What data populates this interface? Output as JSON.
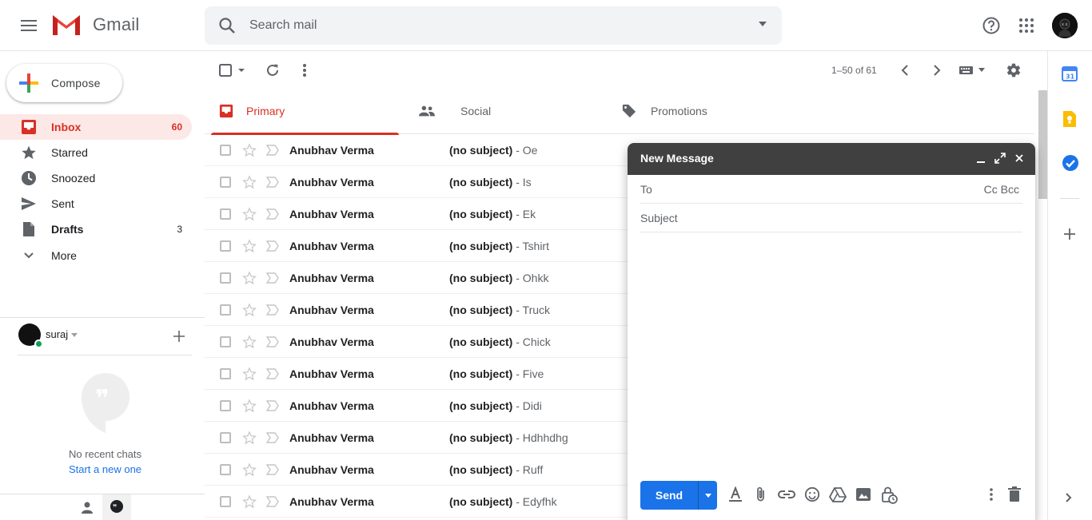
{
  "header": {
    "app_name": "Gmail",
    "search_placeholder": "Search mail"
  },
  "nav": {
    "compose_label": "Compose",
    "items": [
      {
        "label": "Inbox",
        "count": "60",
        "icon": "inbox-icon"
      },
      {
        "label": "Starred",
        "count": "",
        "icon": "star-icon"
      },
      {
        "label": "Snoozed",
        "count": "",
        "icon": "clock-icon"
      },
      {
        "label": "Sent",
        "count": "",
        "icon": "send-icon"
      },
      {
        "label": "Drafts",
        "count": "3",
        "icon": "draft-icon"
      },
      {
        "label": "More",
        "count": "",
        "icon": "chevron-down-icon"
      }
    ]
  },
  "hangouts": {
    "user_name": "suraj",
    "empty_text": "No recent chats",
    "start_link": "Start a new one"
  },
  "toolbar": {
    "pagination": "1–50 of 61"
  },
  "tabs": [
    {
      "label": "Primary",
      "icon": "inbox-icon",
      "active": true
    },
    {
      "label": "Social",
      "icon": "people-icon",
      "active": false
    },
    {
      "label": "Promotions",
      "icon": "tag-icon",
      "active": false
    }
  ],
  "emails": [
    {
      "sender": "Anubhav Verma",
      "subject": "(no subject)",
      "snippet": " - Oe"
    },
    {
      "sender": "Anubhav Verma",
      "subject": "(no subject)",
      "snippet": " - Is"
    },
    {
      "sender": "Anubhav Verma",
      "subject": "(no subject)",
      "snippet": " - Ek"
    },
    {
      "sender": "Anubhav Verma",
      "subject": "(no subject)",
      "snippet": " - Tshirt"
    },
    {
      "sender": "Anubhav Verma",
      "subject": "(no subject)",
      "snippet": " - Ohkk"
    },
    {
      "sender": "Anubhav Verma",
      "subject": "(no subject)",
      "snippet": " - Truck"
    },
    {
      "sender": "Anubhav Verma",
      "subject": "(no subject)",
      "snippet": " - Chick"
    },
    {
      "sender": "Anubhav Verma",
      "subject": "(no subject)",
      "snippet": " - Five"
    },
    {
      "sender": "Anubhav Verma",
      "subject": "(no subject)",
      "snippet": " - Didi"
    },
    {
      "sender": "Anubhav Verma",
      "subject": "(no subject)",
      "snippet": " - Hdhhdhg"
    },
    {
      "sender": "Anubhav Verma",
      "subject": "(no subject)",
      "snippet": " - Ruff"
    },
    {
      "sender": "Anubhav Verma",
      "subject": "(no subject)",
      "snippet": " - Edyfhk"
    }
  ],
  "compose_window": {
    "title": "New Message",
    "to_label": "To",
    "cc_bcc": "Cc Bcc",
    "subject_placeholder": "Subject",
    "send_label": "Send"
  },
  "colors": {
    "accent_red": "#d93025",
    "send_blue": "#1a73e8",
    "compose_header": "#404040"
  }
}
